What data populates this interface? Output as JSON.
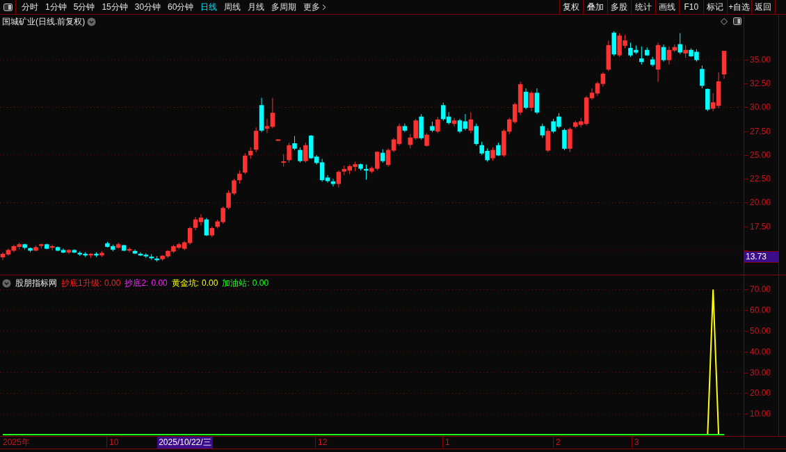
{
  "toolbar": {
    "tabs": [
      {
        "label": "分时",
        "selected": false
      },
      {
        "label": "1分钟",
        "selected": false
      },
      {
        "label": "5分钟",
        "selected": false
      },
      {
        "label": "15分钟",
        "selected": false
      },
      {
        "label": "30分钟",
        "selected": false
      },
      {
        "label": "60分钟",
        "selected": false
      },
      {
        "label": "日线",
        "selected": true
      },
      {
        "label": "周线",
        "selected": false
      },
      {
        "label": "月线",
        "selected": false
      },
      {
        "label": "多周期",
        "selected": false
      },
      {
        "label": "更多",
        "selected": false
      }
    ],
    "buttons": [
      "复权",
      "叠加",
      "多股",
      "统计",
      "画线",
      "F10",
      "标记",
      "+自选",
      "返回"
    ]
  },
  "price_panel": {
    "title": "国城矿业(日线.前复权)",
    "crosshair_price": "13.73",
    "chart_data": {
      "type": "candlestick",
      "grid": true,
      "categories": [
        null,
        null,
        null,
        null,
        null,
        null,
        null,
        null,
        null,
        null,
        null,
        null,
        null,
        null,
        null,
        null,
        null,
        null,
        null,
        null,
        null,
        null,
        null,
        null,
        null,
        null,
        null,
        null,
        null,
        null,
        null,
        null,
        null,
        null,
        null,
        null,
        null,
        null,
        null,
        null,
        null,
        null,
        null,
        null,
        null,
        null,
        null,
        null,
        null,
        null,
        null,
        null,
        null,
        null,
        null,
        null,
        null,
        null,
        null,
        null,
        null,
        null,
        null,
        null,
        null,
        null,
        null,
        null,
        null,
        null,
        null,
        null,
        null,
        null,
        null,
        null,
        null,
        null,
        null,
        null,
        null,
        null,
        null,
        null,
        null,
        null,
        null,
        null,
        null,
        null,
        null,
        null,
        null,
        null,
        null,
        null,
        null,
        null,
        null,
        null,
        null,
        null,
        null,
        null,
        null,
        null,
        null,
        null,
        null,
        null,
        null,
        null,
        null,
        null,
        null,
        null,
        null,
        null,
        null,
        null,
        null,
        null,
        null,
        null,
        null,
        null,
        null,
        null,
        null,
        null,
        null,
        null
      ],
      "ylim": [
        12.37,
        39.74
      ],
      "yticks": [
        {
          "value": 17.5,
          "label": "17.50"
        },
        {
          "value": 20,
          "label": "20.00"
        },
        {
          "value": 22.5,
          "label": "22.50"
        },
        {
          "value": 25,
          "label": "25.00"
        },
        {
          "value": 27.5,
          "label": "27.50"
        },
        {
          "value": 30,
          "label": "30.00"
        },
        {
          "value": 32.5,
          "label": "32.50"
        },
        {
          "value": 35,
          "label": "35.00"
        }
      ],
      "ohlc": [
        [
          14.3,
          14.8,
          14.0,
          14.6
        ],
        [
          14.6,
          15.2,
          14.4,
          15.0
        ],
        [
          15.0,
          15.6,
          14.8,
          15.4
        ],
        [
          15.4,
          15.8,
          15.1,
          15.6
        ],
        [
          15.6,
          15.7,
          15.1,
          15.3
        ],
        [
          15.2,
          15.3,
          14.8,
          15.0
        ],
        [
          15.0,
          15.5,
          14.9,
          15.3
        ],
        [
          15.5,
          15.7,
          15.2,
          15.6
        ],
        [
          15.6,
          15.7,
          15.1,
          15.2
        ],
        [
          15.3,
          15.6,
          15.0,
          15.4
        ],
        [
          15.3,
          15.4,
          14.9,
          15.0
        ],
        [
          15.0,
          15.2,
          14.7,
          14.8
        ],
        [
          14.8,
          15.1,
          14.6,
          15.0
        ],
        [
          15.0,
          15.1,
          14.7,
          14.8
        ],
        [
          14.7,
          14.9,
          14.4,
          14.6
        ],
        [
          14.6,
          14.8,
          14.3,
          14.5
        ],
        [
          14.5,
          14.7,
          14.2,
          14.6
        ],
        [
          14.6,
          14.8,
          14.3,
          14.5
        ],
        [
          14.5,
          14.9,
          14.3,
          14.7
        ],
        [
          15.7,
          15.9,
          15.3,
          15.4
        ],
        [
          15.4,
          15.6,
          14.9,
          15.1
        ],
        [
          15.3,
          15.8,
          15.2,
          15.6
        ],
        [
          15.5,
          15.6,
          14.9,
          15.0
        ],
        [
          15.0,
          15.3,
          14.8,
          15.1
        ],
        [
          14.9,
          15.1,
          14.6,
          14.7
        ],
        [
          14.6,
          14.8,
          14.4,
          14.5
        ],
        [
          14.5,
          14.7,
          14.2,
          14.4
        ],
        [
          14.3,
          14.6,
          14.0,
          14.2
        ],
        [
          14.1,
          14.4,
          13.8,
          14.0
        ],
        [
          14.1,
          14.5,
          13.9,
          14.4
        ],
        [
          14.4,
          15.0,
          14.2,
          14.9
        ],
        [
          14.9,
          15.6,
          14.7,
          15.4
        ],
        [
          15.3,
          15.8,
          15.1,
          15.6
        ],
        [
          15.2,
          16.0,
          15.0,
          15.8
        ],
        [
          15.8,
          17.5,
          15.6,
          17.3
        ],
        [
          17.4,
          18.5,
          17.1,
          18.2
        ],
        [
          18.0,
          18.8,
          17.6,
          18.4
        ],
        [
          18.2,
          18.4,
          16.5,
          16.6
        ],
        [
          16.6,
          17.5,
          16.4,
          17.3
        ],
        [
          17.5,
          18.2,
          17.3,
          18.0
        ],
        [
          18.0,
          19.6,
          17.8,
          19.4
        ],
        [
          19.5,
          21.3,
          19.3,
          21.0
        ],
        [
          21.0,
          22.5,
          20.8,
          22.3
        ],
        [
          22.4,
          23.4,
          22.0,
          23.0
        ],
        [
          23.2,
          25.2,
          23.0,
          24.9
        ],
        [
          25.0,
          25.8,
          24.6,
          25.4
        ],
        [
          25.6,
          27.9,
          25.3,
          27.5
        ],
        [
          30.2,
          31.0,
          27.4,
          27.6
        ],
        [
          27.8,
          28.8,
          27.3,
          28.0
        ],
        [
          28.0,
          31.0,
          27.8,
          29.4
        ],
        [
          26.6,
          26.7,
          26.5,
          26.6
        ],
        [
          24.3,
          25.1,
          23.8,
          24.3
        ],
        [
          24.5,
          26.3,
          24.2,
          26.0
        ],
        [
          26.2,
          27.0,
          25.5,
          25.7
        ],
        [
          25.5,
          25.8,
          24.2,
          24.4
        ],
        [
          24.4,
          26.3,
          24.2,
          26.0
        ],
        [
          27.0,
          27.1,
          24.6,
          24.7
        ],
        [
          24.8,
          25.0,
          24.0,
          24.2
        ],
        [
          24.2,
          24.6,
          22.2,
          22.4
        ],
        [
          22.6,
          22.9,
          22.1,
          22.3
        ],
        [
          22.2,
          22.5,
          21.7,
          22.0
        ],
        [
          22.0,
          23.4,
          21.6,
          23.2
        ],
        [
          23.3,
          23.9,
          22.9,
          23.5
        ],
        [
          23.4,
          24.0,
          23.0,
          23.8
        ],
        [
          23.8,
          24.3,
          23.3,
          24.0
        ],
        [
          24.0,
          24.1,
          23.4,
          23.6
        ],
        [
          23.5,
          24.0,
          22.4,
          23.4
        ],
        [
          23.3,
          23.8,
          23.1,
          23.6
        ],
        [
          23.6,
          25.4,
          23.4,
          25.3
        ],
        [
          25.2,
          25.6,
          24.2,
          24.4
        ],
        [
          24.0,
          25.7,
          23.8,
          25.5
        ],
        [
          25.5,
          26.8,
          25.3,
          26.6
        ],
        [
          26.2,
          28.3,
          26.0,
          28.0
        ],
        [
          28.0,
          28.3,
          27.4,
          27.6
        ],
        [
          26.1,
          27.2,
          25.7,
          26.8
        ],
        [
          26.8,
          28.8,
          26.6,
          28.6
        ],
        [
          29.0,
          29.3,
          26.6,
          26.8
        ],
        [
          26.0,
          27.3,
          25.9,
          27.1
        ],
        [
          28.0,
          28.5,
          27.4,
          27.6
        ],
        [
          27.5,
          29.0,
          27.3,
          28.7
        ],
        [
          30.2,
          30.5,
          28.6,
          28.8
        ],
        [
          29.0,
          29.5,
          28.2,
          28.4
        ],
        [
          28.3,
          28.9,
          28.0,
          28.6
        ],
        [
          28.6,
          28.8,
          27.3,
          27.5
        ],
        [
          28.5,
          29.3,
          27.6,
          27.8
        ],
        [
          27.6,
          29.5,
          27.3,
          28.7
        ],
        [
          28.0,
          28.3,
          26.0,
          26.2
        ],
        [
          26.0,
          26.4,
          25.0,
          25.2
        ],
        [
          25.4,
          25.7,
          24.3,
          24.5
        ],
        [
          24.7,
          25.8,
          24.4,
          25.5
        ],
        [
          26.0,
          26.3,
          24.9,
          25.0
        ],
        [
          25.0,
          27.7,
          24.8,
          27.5
        ],
        [
          27.5,
          28.9,
          27.2,
          28.7
        ],
        [
          28.5,
          30.5,
          28.3,
          30.3
        ],
        [
          29.5,
          32.7,
          29.2,
          32.4
        ],
        [
          31.6,
          32.0,
          29.8,
          30.0
        ],
        [
          30.0,
          31.7,
          29.6,
          31.5
        ],
        [
          31.5,
          32.0,
          29.3,
          29.5
        ],
        [
          28.0,
          28.3,
          26.8,
          27.1
        ],
        [
          25.5,
          27.8,
          25.3,
          27.5
        ],
        [
          28.5,
          28.8,
          27.3,
          27.5
        ],
        [
          29.0,
          29.4,
          27.8,
          28.0
        ],
        [
          27.6,
          27.8,
          25.5,
          25.7
        ],
        [
          25.7,
          27.9,
          25.3,
          27.7
        ],
        [
          28.0,
          28.6,
          27.8,
          28.4
        ],
        [
          28.2,
          28.9,
          27.9,
          28.5
        ],
        [
          28.3,
          31.2,
          28.1,
          31.0
        ],
        [
          31.0,
          32.0,
          30.8,
          31.5
        ],
        [
          31.5,
          32.7,
          31.2,
          32.5
        ],
        [
          32.5,
          33.7,
          32.2,
          33.5
        ],
        [
          34.0,
          37.0,
          33.8,
          36.5
        ],
        [
          37.8,
          38.0,
          35.4,
          35.6
        ],
        [
          35.5,
          37.8,
          35.3,
          37.5
        ],
        [
          36.5,
          37.6,
          36.2,
          37.0
        ],
        [
          36.2,
          36.8,
          35.3,
          35.5
        ],
        [
          36.0,
          36.5,
          35.6,
          35.8
        ],
        [
          35.1,
          36.4,
          34.5,
          34.8
        ],
        [
          36.0,
          36.3,
          35.4,
          35.5
        ],
        [
          35.0,
          35.3,
          34.3,
          34.5
        ],
        [
          34.0,
          36.8,
          32.7,
          36.5
        ],
        [
          36.3,
          36.6,
          34.8,
          35.0
        ],
        [
          35.0,
          36.4,
          34.5,
          36.0
        ],
        [
          36.0,
          36.6,
          35.8,
          36.3
        ],
        [
          36.6,
          37.8,
          35.6,
          35.8
        ],
        [
          35.7,
          36.5,
          35.2,
          36.0
        ],
        [
          36.0,
          36.2,
          35.3,
          35.4
        ],
        [
          35.8,
          36.1,
          34.8,
          35.0
        ],
        [
          34.0,
          34.4,
          32.0,
          32.3
        ],
        [
          31.9,
          32.0,
          29.6,
          29.8
        ],
        [
          29.9,
          31.5,
          29.6,
          30.5
        ],
        [
          30.2,
          33.7,
          29.9,
          32.7
        ],
        [
          33.5,
          35.9,
          33.0,
          35.9
        ]
      ]
    }
  },
  "indicator_panel": {
    "title": "股朋指标网",
    "legend": [
      {
        "label": "抄底1升级:",
        "value": "0.00",
        "color": "#ff2020"
      },
      {
        "label": "抄底2:",
        "value": "0.00",
        "color": "#ff20ff"
      },
      {
        "label": "黄金坑:",
        "value": "0.00",
        "color": "#ffff00"
      },
      {
        "label": "加油站:",
        "value": "0.00",
        "color": "#20ff20"
      }
    ],
    "chart_data": {
      "type": "line",
      "grid": true,
      "categories": [
        null,
        null,
        null,
        null,
        null,
        null,
        null,
        null,
        null,
        null,
        null,
        null,
        null,
        null,
        null,
        null,
        null,
        null,
        null,
        null,
        null,
        null,
        null,
        null,
        null,
        null,
        null,
        null,
        null,
        null,
        null,
        null,
        null,
        null,
        null,
        null,
        null,
        null,
        null,
        null,
        null,
        null,
        null,
        null,
        null,
        null,
        null,
        null,
        null,
        null,
        null,
        null,
        null,
        null,
        null,
        null,
        null,
        null,
        null,
        null,
        null,
        null,
        null,
        null,
        null,
        null,
        null,
        null,
        null,
        null,
        null,
        null,
        null,
        null,
        null,
        null,
        null,
        null,
        null,
        null,
        null,
        null,
        null,
        null,
        null,
        null,
        null,
        null,
        null,
        null,
        null,
        null,
        null,
        null,
        null,
        null,
        null,
        null,
        null,
        null,
        null,
        null,
        null,
        null,
        null,
        null,
        null,
        null,
        null,
        null,
        null,
        null,
        null,
        null,
        null,
        null,
        null,
        null,
        null,
        null,
        null,
        null,
        null,
        null,
        null,
        null,
        null,
        null,
        null,
        null,
        null,
        null
      ],
      "ylim": [
        0,
        70
      ],
      "yticks": [
        {
          "value": 10,
          "label": "10.00"
        },
        {
          "value": 20,
          "label": "20.00"
        },
        {
          "value": 30,
          "label": "30.00"
        },
        {
          "value": 40,
          "label": "40.00"
        },
        {
          "value": 50,
          "label": "50.00"
        },
        {
          "value": 60,
          "label": "60.00"
        },
        {
          "value": 70,
          "label": "70.00"
        }
      ],
      "series": [
        {
          "color": "#ffff00",
          "values": [
            null,
            null,
            null,
            null,
            null,
            null,
            null,
            null,
            null,
            null,
            null,
            null,
            null,
            null,
            null,
            null,
            null,
            null,
            null,
            null,
            null,
            null,
            null,
            null,
            null,
            null,
            null,
            null,
            null,
            null,
            null,
            null,
            null,
            null,
            null,
            null,
            null,
            null,
            null,
            null,
            null,
            null,
            null,
            null,
            null,
            null,
            null,
            null,
            null,
            null,
            null,
            null,
            null,
            null,
            null,
            null,
            null,
            null,
            null,
            null,
            null,
            null,
            null,
            null,
            null,
            null,
            null,
            null,
            null,
            null,
            null,
            null,
            null,
            null,
            null,
            null,
            null,
            null,
            null,
            null,
            null,
            null,
            null,
            null,
            null,
            null,
            null,
            null,
            null,
            null,
            null,
            null,
            null,
            null,
            null,
            null,
            null,
            null,
            null,
            null,
            null,
            null,
            null,
            null,
            null,
            null,
            null,
            null,
            null,
            null,
            null,
            null,
            null,
            null,
            null,
            null,
            null,
            null,
            null,
            null,
            null,
            null,
            null,
            null,
            null,
            null,
            null,
            null,
            0,
            70,
            0,
            null
          ]
        },
        {
          "color": "#20ff20",
          "values": [
            0,
            0,
            0,
            0,
            0,
            0,
            0,
            0,
            0,
            0,
            0,
            0,
            0,
            0,
            0,
            0,
            0,
            0,
            0,
            0,
            0,
            0,
            0,
            0,
            0,
            0,
            0,
            0,
            0,
            0,
            0,
            0,
            0,
            0,
            0,
            0,
            0,
            0,
            0,
            0,
            0,
            0,
            0,
            0,
            0,
            0,
            0,
            0,
            0,
            0,
            0,
            0,
            0,
            0,
            0,
            0,
            0,
            0,
            0,
            0,
            0,
            0,
            0,
            0,
            0,
            0,
            0,
            0,
            0,
            0,
            0,
            0,
            0,
            0,
            0,
            0,
            0,
            0,
            0,
            0,
            0,
            0,
            0,
            0,
            0,
            0,
            0,
            0,
            0,
            0,
            0,
            0,
            0,
            0,
            0,
            0,
            0,
            0,
            0,
            0,
            0,
            0,
            0,
            0,
            0,
            0,
            0,
            0,
            0,
            0,
            0,
            0,
            0,
            0,
            0,
            0,
            0,
            0,
            0,
            0,
            0,
            0,
            0,
            0,
            0,
            0,
            0,
            0,
            0,
            0,
            0,
            0
          ]
        }
      ]
    }
  },
  "date_axis": {
    "labels": [
      "2025年",
      "10",
      "12",
      "1",
      "2",
      "3"
    ],
    "crosshair_date": "2025/10/22/三"
  }
}
